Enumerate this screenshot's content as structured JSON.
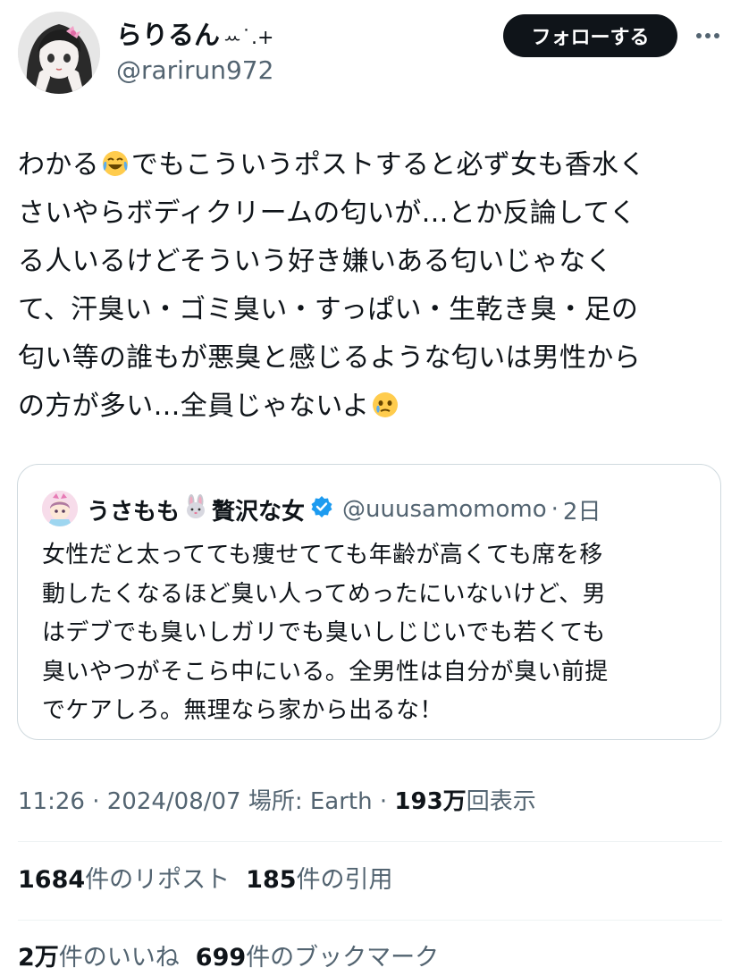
{
  "author": {
    "display_name": "らりるん",
    "name_decoration": "ꕀ˙.+",
    "handle": "@rarirun972"
  },
  "actions": {
    "follow_label": "フォローする"
  },
  "tweet": {
    "segments": [
      {
        "t": "わかる"
      },
      {
        "emoji": "joy-emoji"
      },
      {
        "t": "でもこういうポストすると必ず女も香水く"
      },
      {
        "br": true
      },
      {
        "t": "さいやらボディクリームの匂いが…とか反論してく"
      },
      {
        "br": true
      },
      {
        "t": "る人いるけどそういう好き嫌いある匂いじゃなく"
      },
      {
        "br": true
      },
      {
        "t": "て、汗臭い・ゴミ臭い・すっぱい・生乾き臭・足の"
      },
      {
        "br": true
      },
      {
        "t": "匂い等の誰もが悪臭と感じるような匂いは男性から"
      },
      {
        "br": true
      },
      {
        "t": "の方が多い…全員じゃないよ"
      },
      {
        "emoji": "holding-back-tears-emoji"
      }
    ]
  },
  "quote": {
    "name": "うさもも",
    "name_emoji": "rabbit-face-emoji",
    "name_suffix": "贅沢な女",
    "verified_icon": "verified-badge-icon",
    "handle": "@uuusamomomo",
    "separator": "·",
    "time": "2日",
    "lines": [
      "女性だと太ってても痩せてても年齢が高くても席を移",
      "動したくなるほど臭い人ってめったにいないけど、男",
      "はデブでも臭いしガリでも臭いしじじいでも若くても",
      "臭いやつがそこら中にいる。全男性は自分が臭い前提",
      "でケアしろ。無理なら家から出るな！"
    ]
  },
  "meta": {
    "time": "11:26",
    "separator": "·",
    "date": "2024/08/07",
    "location_label": "場所: Earth",
    "views_count": "193万",
    "views_label": "回表示"
  },
  "stats": {
    "reposts_count": "1684",
    "reposts_label": "件のリポスト",
    "quotes_count": "185",
    "quotes_label": "件の引用",
    "likes_count": "2万",
    "likes_label": "件のいいね",
    "bookmarks_count": "699",
    "bookmarks_label": "件のブックマーク"
  },
  "colors": {
    "text": "#0f1419",
    "secondary": "#536471",
    "border": "#cfd9de",
    "verified": "#1d9bf0",
    "follow_bg": "#0f1419"
  }
}
